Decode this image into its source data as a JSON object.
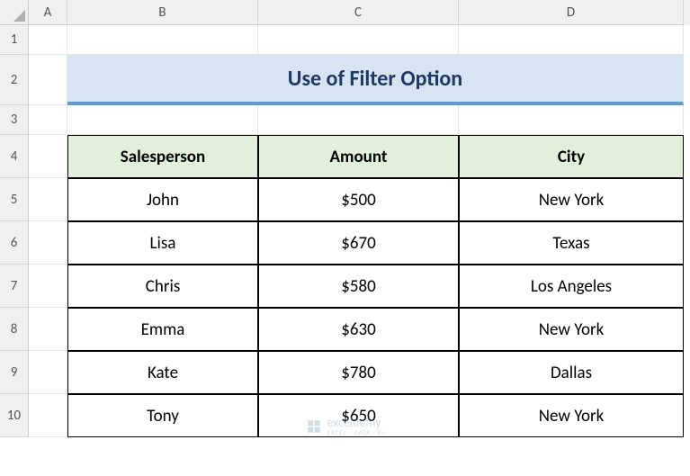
{
  "columns": {
    "A": "A",
    "B": "B",
    "C": "C",
    "D": "D"
  },
  "rows": {
    "r1": "1",
    "r2": "2",
    "r3": "3",
    "r4": "4",
    "r5": "5",
    "r6": "6",
    "r7": "7",
    "r8": "8",
    "r9": "9",
    "r10": "10"
  },
  "title": "Use of Filter Option",
  "headers": {
    "salesperson": "Salesperson",
    "amount": "Amount",
    "city": "City"
  },
  "table": [
    {
      "salesperson": "John",
      "amount": "$500",
      "city": "New York"
    },
    {
      "salesperson": "Lisa",
      "amount": "$670",
      "city": "Texas"
    },
    {
      "salesperson": "Chris",
      "amount": "$580",
      "city": "Los Angeles"
    },
    {
      "salesperson": "Emma",
      "amount": "$630",
      "city": "New York"
    },
    {
      "salesperson": "Kate",
      "amount": "$780",
      "city": "Dallas"
    },
    {
      "salesperson": "Tony",
      "amount": "$650",
      "city": "New York"
    }
  ],
  "watermark": {
    "main": "exceldemy",
    "sub": "EXCEL · DATA · BI"
  }
}
